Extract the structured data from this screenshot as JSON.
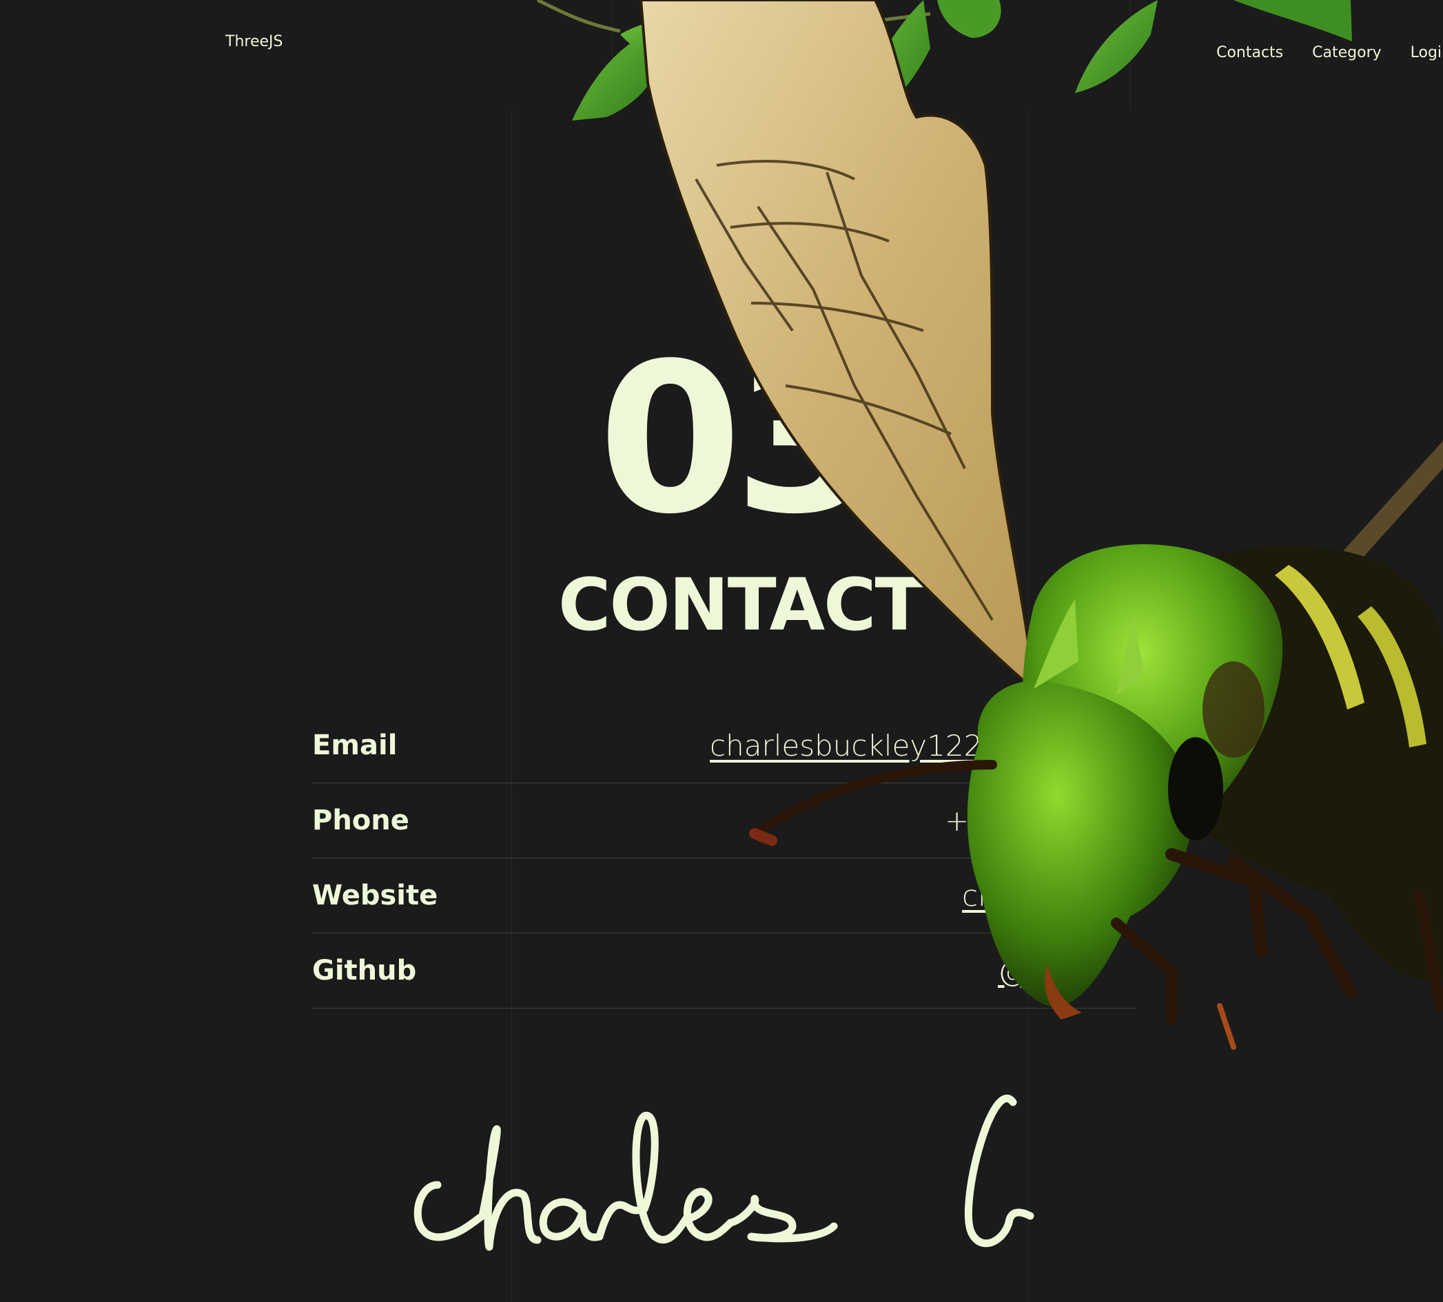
{
  "header": {
    "brand": "ThreeJS",
    "nav": [
      "Contacts",
      "Category",
      "Login"
    ]
  },
  "hero": {
    "number": "03",
    "title": "CONTACT"
  },
  "contacts": [
    {
      "label": "Email",
      "value": "charlesbuckley122@"
    },
    {
      "label": "Phone",
      "value": "+"
    },
    {
      "label": "Website",
      "value": "cha"
    },
    {
      "label": "Github",
      "value": "@0       x"
    }
  ],
  "signature": "charles b",
  "colors": {
    "background": "#1b1b1b",
    "text": "#eef7d8",
    "divider": "#3e4334"
  }
}
